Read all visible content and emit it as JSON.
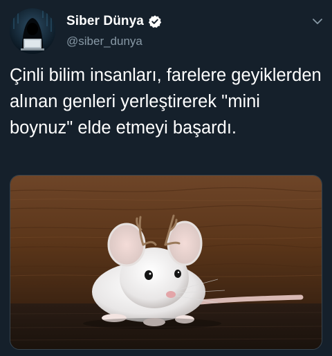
{
  "tweet": {
    "author": {
      "display_name": "Siber Dünya",
      "handle": "@siber_dunya",
      "verified": true
    },
    "text": "Çinli bilim insanları, farelere geyiklerden alınan genleri yerleştirerek \"mini boynuz\" elde etmeyi başardı.",
    "media": {
      "kind": "photo"
    },
    "icons": {
      "verified": "verified-badge-icon",
      "menu": "chevron-down-icon"
    }
  },
  "colors": {
    "background": "#15202b",
    "primary_text": "#ffffff",
    "secondary_text": "#8899a6",
    "border": "#38444d"
  }
}
